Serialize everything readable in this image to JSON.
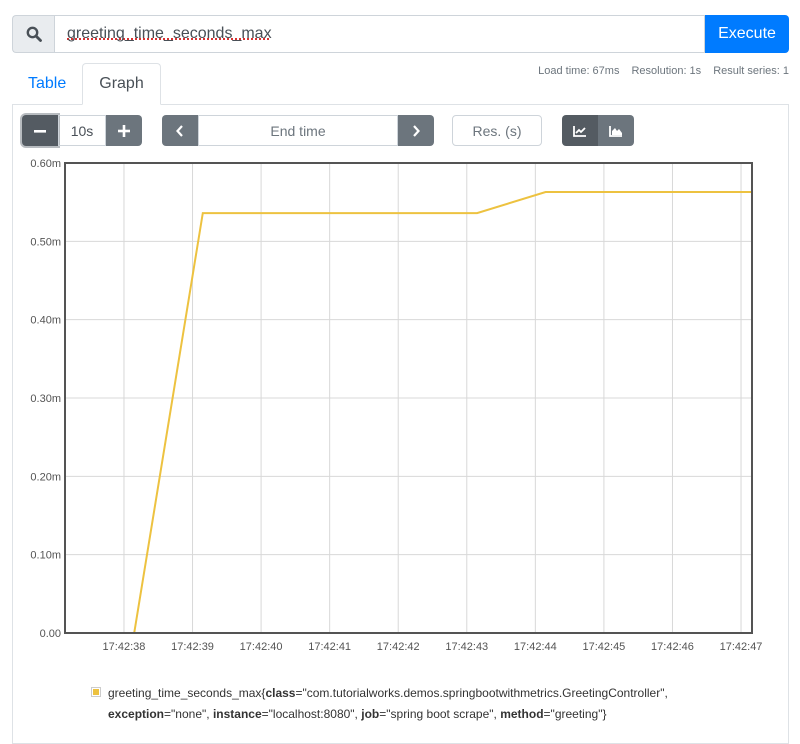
{
  "query": {
    "value": "greeting_time_seconds_max",
    "execute_label": "Execute",
    "search_icon": "search-icon"
  },
  "stats": {
    "load_time": "Load time: 67ms",
    "resolution": "Resolution: 1s",
    "result_series": "Result series: 1"
  },
  "tabs": [
    {
      "label": "Table",
      "active": false
    },
    {
      "label": "Graph",
      "active": true
    }
  ],
  "controls": {
    "range_value": "10s",
    "decrease_icon": "minus-icon",
    "increase_icon": "plus-icon",
    "end_time_placeholder": "End time",
    "prev_icon": "chevron-left-icon",
    "next_icon": "chevron-right-icon",
    "resolution_placeholder": "Res. (s)",
    "line_chart_icon": "line-chart-icon",
    "stacked_chart_icon": "area-chart-icon"
  },
  "colors": {
    "accent": "#007bff",
    "series": "#edc240"
  },
  "legend": {
    "metric": "greeting_time_seconds_max",
    "labels": [
      {
        "key": "class",
        "value": "com.tutorialworks.demos.springbootwithmetrics.GreetingController"
      },
      {
        "key": "exception",
        "value": "none"
      },
      {
        "key": "instance",
        "value": "localhost:8080"
      },
      {
        "key": "job",
        "value": "spring boot scrape"
      },
      {
        "key": "method",
        "value": "greeting"
      }
    ]
  },
  "chart_data": {
    "type": "line",
    "title": "",
    "xlabel": "",
    "ylabel": "",
    "grid": true,
    "x_ticks": [
      "17:42:38",
      "17:42:39",
      "17:42:40",
      "17:42:41",
      "17:42:42",
      "17:42:43",
      "17:42:44",
      "17:42:45",
      "17:42:46",
      "17:42:47"
    ],
    "y_ticks": [
      "0.00",
      "0.10m",
      "0.20m",
      "0.30m",
      "0.40m",
      "0.50m",
      "0.60m"
    ],
    "xlim_seconds_after_17_42_00": [
      37.14,
      47.16
    ],
    "ylim_milliseconds": [
      0,
      0.6
    ],
    "series": [
      {
        "name": "greeting_time_seconds_max{class=\"com.tutorialworks.demos.springbootwithmetrics.GreetingController\", exception=\"none\", instance=\"localhost:8080\", job=\"spring boot scrape\", method=\"greeting\"}",
        "x_seconds_after_17_42_00": [
          37.15,
          38.15,
          39.15,
          40.15,
          41.15,
          42.15,
          43.15,
          44.15,
          45.15,
          46.15,
          47.15
        ],
        "values_milliseconds": [
          0,
          0,
          0.536,
          0.536,
          0.536,
          0.536,
          0.536,
          0.563,
          0.563,
          0.563,
          0.563
        ]
      }
    ]
  }
}
